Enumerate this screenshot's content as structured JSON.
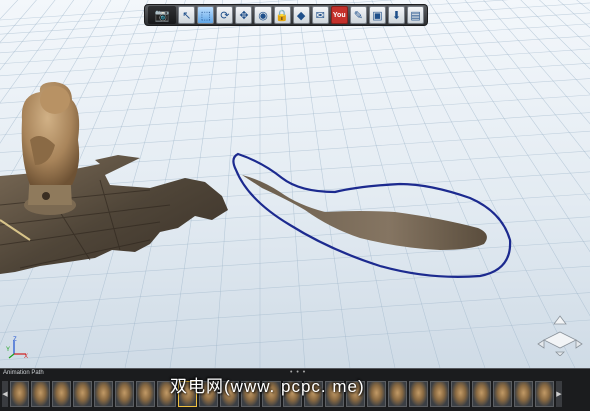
{
  "toolbar": {
    "buttons": [
      {
        "name": "camera-icon",
        "glyph": "📷"
      },
      {
        "name": "pointer-icon",
        "glyph": "↖"
      },
      {
        "name": "select-icon",
        "glyph": "⬚"
      },
      {
        "name": "orbit-icon",
        "glyph": "⟳"
      },
      {
        "name": "pan-icon",
        "glyph": "✥"
      },
      {
        "name": "eye-icon",
        "glyph": "◉"
      },
      {
        "name": "lock-icon",
        "glyph": "🔒"
      },
      {
        "name": "diamond-icon",
        "glyph": "◆"
      },
      {
        "name": "mail-icon",
        "glyph": "✉"
      },
      {
        "name": "youtube-icon",
        "glyph": "You"
      },
      {
        "name": "pen-icon",
        "glyph": "✎"
      },
      {
        "name": "layout-icon",
        "glyph": "▣"
      },
      {
        "name": "download-icon",
        "glyph": "⬇"
      },
      {
        "name": "document-icon",
        "glyph": "▤"
      }
    ]
  },
  "axis": {
    "z": "Z",
    "y": "Y",
    "x": "X"
  },
  "bottom_panel": {
    "title": "Animation Path",
    "grip": "• • •",
    "prev": "◀",
    "next": "▶",
    "thumbnail_count": 26
  },
  "watermark": "双电网(www. pcpc. me)",
  "colors": {
    "selection_outline": "#1c2a8f",
    "toolbar": "#3a3c40",
    "ground": "#efe9e2"
  }
}
